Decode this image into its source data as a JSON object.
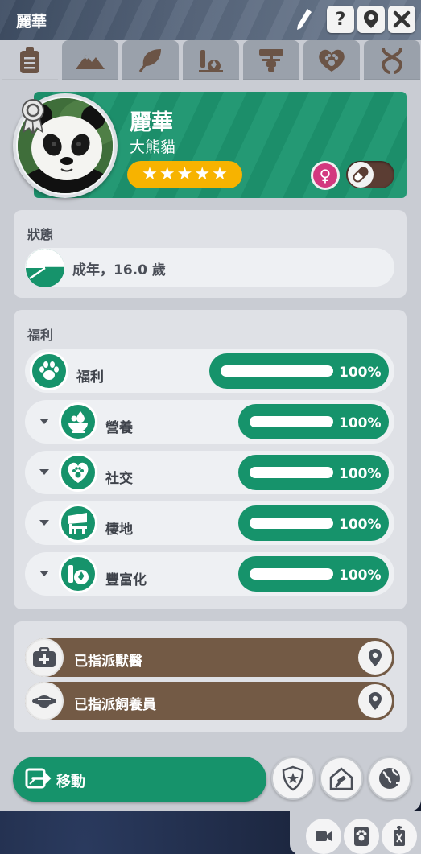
{
  "window": {
    "title": "麗華",
    "help_label": "?"
  },
  "tabs": [
    {
      "name": "info",
      "icon": "clipboard-icon",
      "active": true
    },
    {
      "name": "habitat",
      "icon": "mountain-icon"
    },
    {
      "name": "diet",
      "icon": "leaf-icon"
    },
    {
      "name": "enrichment",
      "icon": "enrichment-icon"
    },
    {
      "name": "family",
      "icon": "family-tree-icon"
    },
    {
      "name": "social",
      "icon": "heart-paw-icon"
    },
    {
      "name": "genetics",
      "icon": "dna-icon"
    }
  ],
  "animal": {
    "name": "麗華",
    "species": "大熊貓",
    "stars": 5,
    "sex": "female",
    "contraceptive_on": false
  },
  "status": {
    "title": "狀態",
    "value": "成年，16.0 歲"
  },
  "welfare": {
    "title": "福利",
    "overall": {
      "label": "福利",
      "value": 1.0,
      "percent_text": "100%"
    },
    "items": [
      {
        "label": "營養",
        "value": 1.0,
        "percent_text": "100%"
      },
      {
        "label": "社交",
        "value": 1.0,
        "percent_text": "100%"
      },
      {
        "label": "棲地",
        "value": 1.0,
        "percent_text": "100%"
      },
      {
        "label": "豐富化",
        "value": 1.0,
        "percent_text": "100%"
      }
    ]
  },
  "staff": {
    "vet_label": "已指派獸醫",
    "keeper_label": "已指派飼養員"
  },
  "actions": {
    "move_label": "移動"
  },
  "colors": {
    "green": "#16936b",
    "brown": "#735a45",
    "gold": "#f7b300",
    "pink": "#d3387f"
  }
}
